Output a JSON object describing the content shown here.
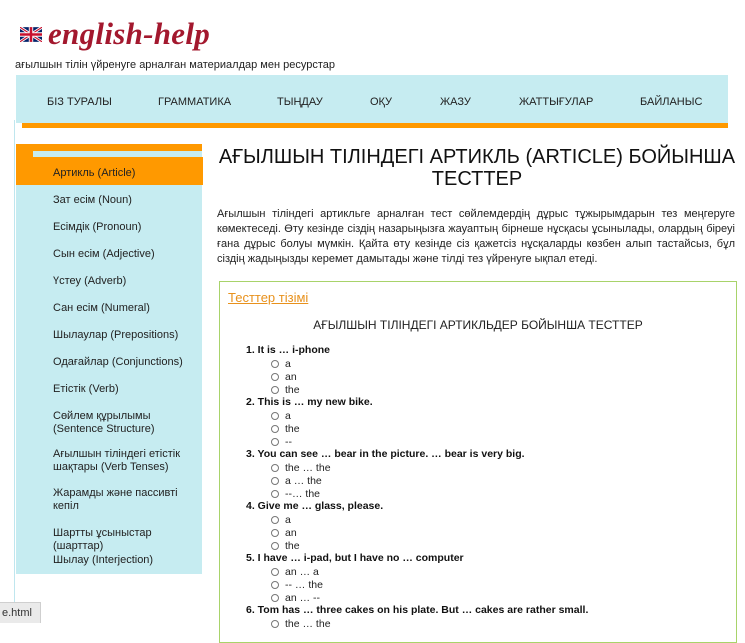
{
  "site": {
    "logo_text": "english-help",
    "flag_icon": "uk-flag-icon",
    "tagline": "ағылшын тілін үйренуге арналған материалдар мен ресурстар"
  },
  "nav": {
    "items": [
      "БІЗ ТУРАЛЫ",
      "ГРАММАТИКА",
      "ТЫҢДАУ",
      "ОҚУ",
      "ЖАЗУ",
      "ЖАТТЫҒУЛАР",
      "БАЙЛАНЫС"
    ]
  },
  "sidebar": {
    "items": [
      "Артикль (Article)",
      "Зат есім (Noun)",
      "Есімдік (Pronoun)",
      "Сын есім (Adjective)",
      "Үстеу (Adverb)",
      "Сан есім (Numeral)",
      "Шылаулар (Prepositions)",
      "Одағайлар (Conjunctions)",
      "Етістік (Verb)",
      "Сөйлем құрылымы (Sentence Structure)",
      "Ағылшын тіліндегі етістік шақтары (Verb Tenses)",
      "Жарамды және пассивті кепіл",
      "Шартты ұсыныстар (шарттар)",
      "Шылау (Interjection)"
    ],
    "active_index": 0
  },
  "main": {
    "title": "АҒЫЛШЫН ТІЛІНДЕГІ АРТИКЛЬ (ARTICLE) БОЙЫНША ТЕСТТЕР",
    "intro": "Ағылшын тіліндегі артикльге арналған тест сөйлемдердің дұрыс тұжырымдарын тез меңгеруге көмектеседі. Өту кезінде сіздің назарыңызға жауаптың бірнеше нұсқасы ұсынылады, олардың біреуі ғана дұрыс болуы мүмкін. Қайта өту кезінде сіз қажетсіз нұсқаларды көзбен алып тастайсыз, бұл сіздің жадыңызды керемет дамытады және тілді тез үйренуге ықпал етеді.",
    "tests_link": "Тесттер тізімі",
    "tests_heading": "АҒЫЛШЫН ТІЛІНДЕГІ АРТИКЛЬДЕР БОЙЫНША ТЕСТТЕР",
    "questions": [
      {
        "q": "1. It is … i-phone",
        "options": [
          "a",
          "an",
          "the"
        ]
      },
      {
        "q": "2. This is … my new bike.",
        "options": [
          "a",
          "the",
          "--"
        ]
      },
      {
        "q": "3. You can see … bear in the picture. … bear is very big.",
        "options": [
          "the … the",
          "a … the",
          "--… the"
        ]
      },
      {
        "q": "4. Give me … glass, please.",
        "options": [
          "a",
          "an",
          "the"
        ]
      },
      {
        "q": "5. I have … i-pad, but I have no … computer",
        "options": [
          "an … a",
          "-- … the",
          "an … --"
        ]
      },
      {
        "q": "6. Tom has … three cakes on his plate. But … cakes are rather small.",
        "options": [
          "the … the"
        ]
      }
    ]
  },
  "status_bar": {
    "text": "e.html"
  }
}
